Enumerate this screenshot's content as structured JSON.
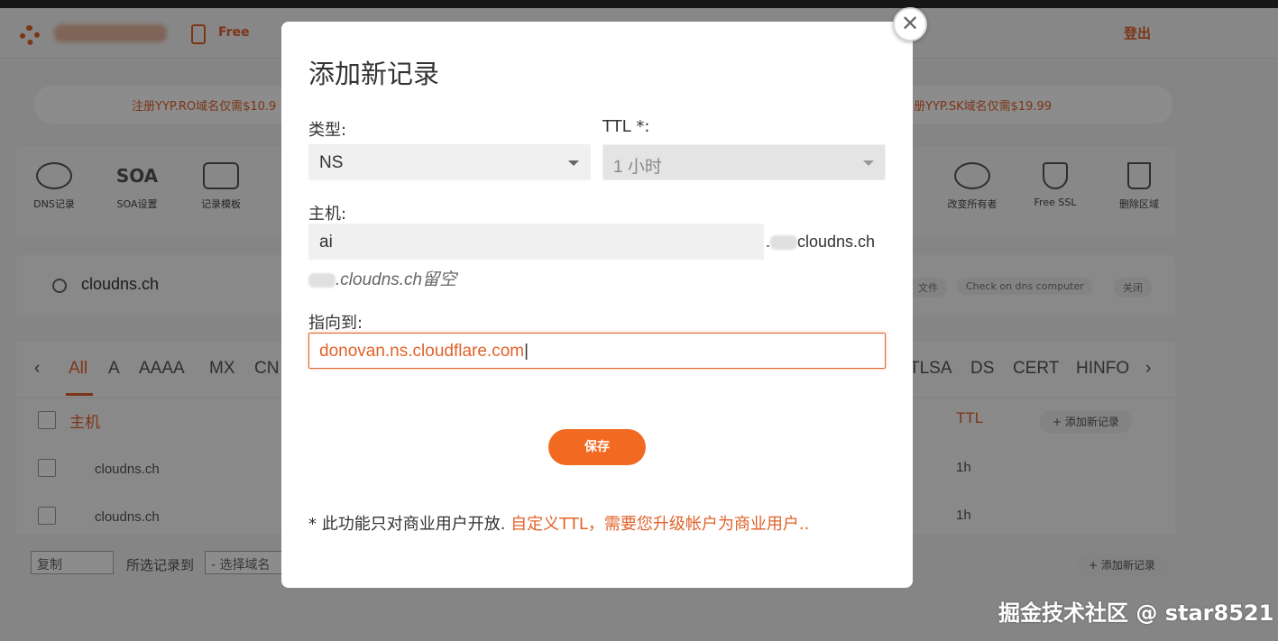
{
  "header": {
    "free_label": "Free",
    "logout_label": "登出"
  },
  "promo": {
    "left_text": "注册YYP.RO域名仅需$10.9",
    "right_text": "册YYP.SK域名仅需$19.99"
  },
  "toolbar": {
    "items": [
      {
        "label": "DNS记录",
        "icon": "globe-icon"
      },
      {
        "label": "SOA设置",
        "icon": "soa-icon"
      },
      {
        "label": "记录模板",
        "icon": "template-icon"
      },
      {
        "label": "改变所有者",
        "icon": "transfer-icon"
      },
      {
        "label": "Free SSL",
        "icon": "ssl-icon"
      },
      {
        "label": "删除区域",
        "icon": "trash-icon"
      }
    ],
    "soa_glyph": "SOA"
  },
  "search": {
    "domain": "cloudns.ch",
    "pills": [
      "文件",
      "Check on dns computer",
      "关闭"
    ]
  },
  "record_tabs": {
    "left": [
      "All",
      "A",
      "AAAA",
      "MX",
      "CN"
    ],
    "right": [
      "TLSA",
      "DS",
      "CERT",
      "HINFO"
    ],
    "active": "All"
  },
  "table": {
    "host_header": "主机",
    "ttl_header": "TTL",
    "add_button": "+ 添加新记录",
    "rows": [
      {
        "host": "cloudns.ch",
        "ttl": "1h"
      },
      {
        "host": "cloudns.ch",
        "ttl": "1h"
      }
    ]
  },
  "footer": {
    "copy_select": "复制",
    "selected_to_label": "所选记录到",
    "domain_select": "- 选择域名",
    "add_button": "+ 添加新记录"
  },
  "modal": {
    "title": "添加新记录",
    "type_label": "类型:",
    "type_value": "NS",
    "ttl_label": "TTL *:",
    "ttl_value": "1 小时",
    "host_label": "主机:",
    "host_value": "ai",
    "host_suffix": "cloudns.ch",
    "host_hint": ".cloudns.ch留空",
    "points_to_label": "指向到:",
    "points_to_value": "donovan.ns.cloudflare.com",
    "save_label": "保存",
    "note_text": "* 此功能只对商业用户开放. ",
    "note_link": "自定义TTL，需要您升级帐户为商业用户..",
    "close_glyph": "✕"
  },
  "watermark": "掘金技术社区 @ star8521",
  "colors": {
    "accent": "#e2622a",
    "save_button": "#f26a21"
  }
}
